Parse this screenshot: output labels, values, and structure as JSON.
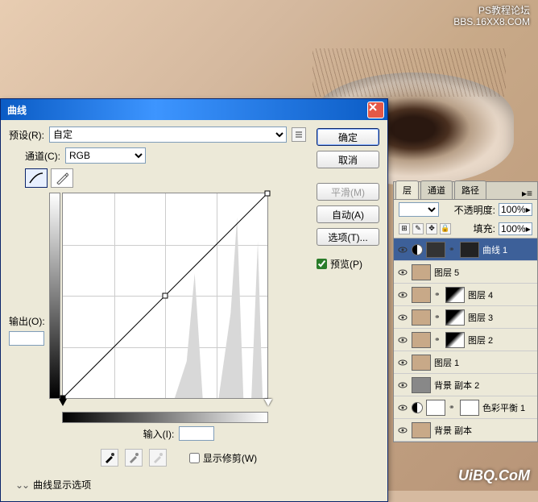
{
  "watermark": {
    "line1": "PS教程论坛",
    "line2": "BBS.16XX8.COM",
    "bottom": "UiBQ.CoM"
  },
  "dialog": {
    "title": "曲线",
    "preset_label": "预设(R):",
    "preset_value": "自定",
    "channel_label": "通道(C):",
    "channel_value": "RGB",
    "output_label": "输出(O):",
    "input_label": "输入(I):",
    "show_clip": "显示修剪(W)",
    "expand": "曲线显示选项",
    "buttons": {
      "ok": "确定",
      "cancel": "取消",
      "smooth": "平滑(M)",
      "auto": "自动(A)",
      "options": "选项(T)...",
      "preview": "预览(P)"
    }
  },
  "panel": {
    "tabs": {
      "layers": "层",
      "channels": "通道",
      "paths": "路径"
    },
    "opacity_label": "不透明度:",
    "opacity_value": "100%",
    "fill_label": "填充:",
    "fill_value": "100%",
    "lock_label": "锁定:"
  },
  "layers": [
    {
      "name": "曲线 1",
      "selected": true,
      "type": "adj",
      "mask": true
    },
    {
      "name": "图层 5",
      "selected": false,
      "type": "img",
      "mask": false
    },
    {
      "name": "图层 4",
      "selected": false,
      "type": "img",
      "mask": true
    },
    {
      "name": "图层 3",
      "selected": false,
      "type": "img",
      "mask": true
    },
    {
      "name": "图层 2",
      "selected": false,
      "type": "img",
      "mask": true
    },
    {
      "name": "图层 1",
      "selected": false,
      "type": "img",
      "mask": false
    },
    {
      "name": "背景 副本 2",
      "selected": false,
      "type": "gray",
      "mask": false
    },
    {
      "name": "色彩平衡 1",
      "selected": false,
      "type": "adj",
      "mask": true,
      "maskWhite": true
    },
    {
      "name": "背景 副本",
      "selected": false,
      "type": "img",
      "mask": false
    }
  ]
}
